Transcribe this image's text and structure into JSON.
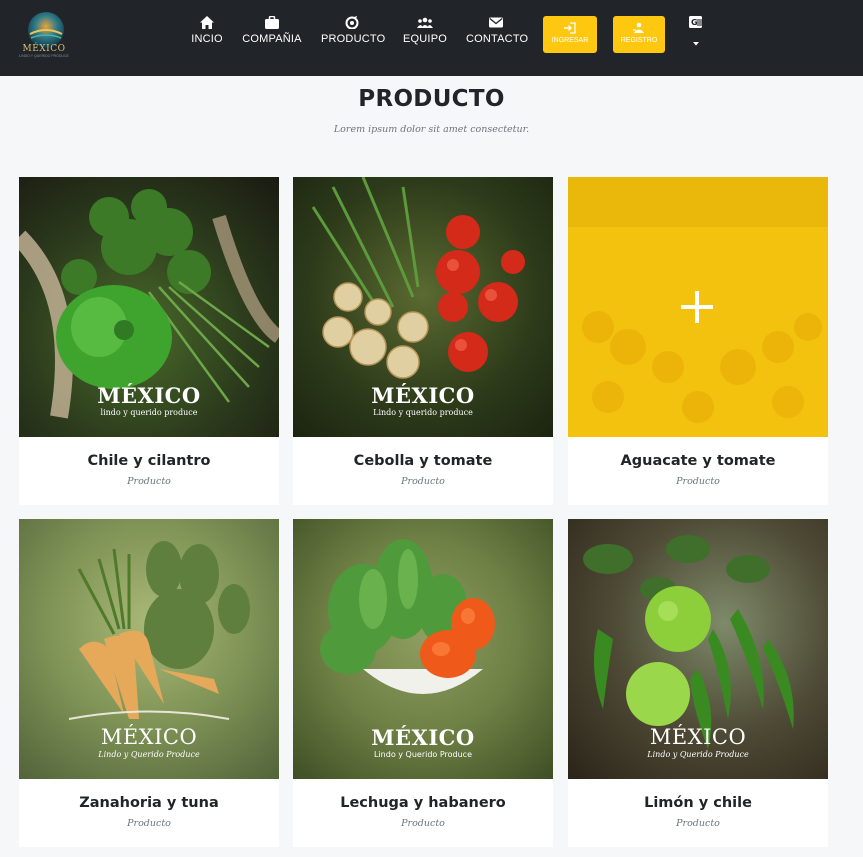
{
  "navbar": {
    "logo_text": "MÉXICO",
    "logo_subtext": "LINDO Y QUERIDO PRODUCE",
    "items": [
      {
        "label": "INCIO",
        "icon": "home-icon"
      },
      {
        "label": "COMPAÑIA",
        "icon": "briefcase-icon"
      },
      {
        "label": "PRODUCTO",
        "icon": "product-icon"
      },
      {
        "label": "EQUIPO",
        "icon": "team-icon"
      },
      {
        "label": "CONTACTO",
        "icon": "envelope-icon"
      }
    ],
    "buttons": [
      {
        "label": "INGRESAR",
        "icon": "sign-in-icon"
      },
      {
        "label": "REGISTRO",
        "icon": "register-icon"
      }
    ],
    "language_icon": "translate-icon",
    "accent_color": "#fec810",
    "background_color": "#212529"
  },
  "section": {
    "title": "PRODUCTO",
    "subtitle": "Lorem ipsum dolor sit amet consectetur."
  },
  "products": [
    {
      "name": "Chile y cilantro",
      "category": "Producto",
      "brand": "MÉXICO",
      "brand_sub": "lindo y querido produce"
    },
    {
      "name": "Cebolla y tomate",
      "category": "Producto",
      "brand": "MÉXICO",
      "brand_sub": "Lindo y querido produce"
    },
    {
      "name": "Aguacate y tomate",
      "category": "Producto",
      "hover_icon": "plus-icon"
    },
    {
      "name": "Zanahoria y tuna",
      "category": "Producto",
      "brand": "MÉXICO",
      "brand_sub": "Lindo y Querido Produce"
    },
    {
      "name": "Lechuga y habanero",
      "category": "Producto",
      "brand": "MÉXICO",
      "brand_sub": "Lindo y Querido Produce"
    },
    {
      "name": "Limón y chile",
      "category": "Producto",
      "brand": "MÉXICO",
      "brand_sub": "Lindo y Querido Produce"
    }
  ]
}
